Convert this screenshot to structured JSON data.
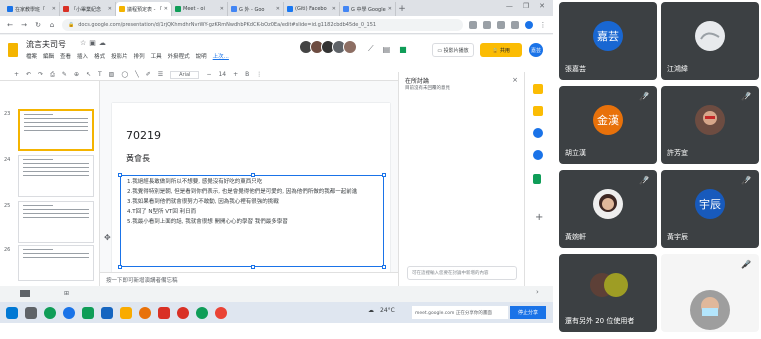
{
  "browser": {
    "tabs": [
      {
        "title": "在家教學班「",
        "color": "#1a73e8"
      },
      {
        "title": "「小畢業紀念",
        "color": "#d93025"
      },
      {
        "title": "議程預定表 - 「",
        "color": "#f4b400",
        "active": true
      },
      {
        "title": "Meet - oi",
        "color": "#0f9d58"
      },
      {
        "title": "G 外 - Goo",
        "color": "#4285f4"
      },
      {
        "title": "(Giti) Facebo",
        "color": "#1877f2"
      },
      {
        "title": "G 中學 Google",
        "color": "#4285f4"
      }
    ],
    "new_tab": "+",
    "url": "docs.google.com/presentation/d/1rjQKhmdhrNvrWY-gzKRmNwdhbPKdCK-bOz0Ea/edit#slide=id.g1182cbdb45de_0_151"
  },
  "slides": {
    "doc_title": "流言夫司号",
    "menu": [
      "檔案",
      "編輯",
      "查看",
      "插入",
      "格式",
      "投影片",
      "排列",
      "工具",
      "外掛程式",
      "說明",
      "上次..."
    ],
    "present_label": "▭ 投影片播放",
    "share_label": "🔒 共用",
    "user_initial": "嘉芸",
    "font": "Arial",
    "font_size": "14",
    "slide_numbers": [
      "23",
      "24",
      "25",
      "26"
    ],
    "slide": {
      "title": "70219",
      "subtitle": "黃會長",
      "bullets": [
        "1.我絕經長敢做到所以不想要, 感覺沒有好吃的東西只吃",
        "2.我覺得特別是朝, 但是看到你們表示, 也是會覺得他們是可愛的, 因為他們所做的我都一起前進",
        "3.我如果看到他們就會很努力不敢動, 因為我心裡有很強的挑戰",
        "4.T回了 N型所 VT回 利日而",
        "5.我最小看到上面的話, 我就會很想 開開心心的學習 我們最多學習"
      ]
    },
    "notes": "按一下即可新增演講者備忘稿"
  },
  "comments": {
    "title": "在所討論",
    "subtitle": "目前沒有未回覆的意見",
    "close": "×",
    "input_placeholder": "可在這裡輸入您要在討論中新增的內容"
  },
  "taskbar": {
    "weather": "24°C",
    "meet_notice": "meet.google.com 正在分享你的畫面",
    "stop_share": "停止分享"
  },
  "participants": [
    {
      "name": "張嘉芸",
      "initial": "嘉芸",
      "type": "avatar",
      "color": "#1967d2",
      "muted": false
    },
    {
      "name": "江鴻緯",
      "type": "photo",
      "muted": false
    },
    {
      "name": "胡立漢",
      "initial": "金漢",
      "type": "avatar",
      "color": "#e8710a",
      "muted": true
    },
    {
      "name": "許芳宜",
      "type": "photo",
      "muted": true
    },
    {
      "name": "黃婉軒",
      "type": "photo",
      "muted": true
    },
    {
      "name": "黃宇辰",
      "initial": "宇辰",
      "type": "avatar",
      "color": "#185abc",
      "muted": true
    },
    {
      "name": "還有另外 20 位使用者",
      "type": "photo",
      "muted": false
    },
    {
      "name": "",
      "type": "photo",
      "muted": true
    }
  ],
  "icons": {
    "mic_off": "mic-off-icon",
    "close": "close-icon",
    "add": "add-icon"
  }
}
